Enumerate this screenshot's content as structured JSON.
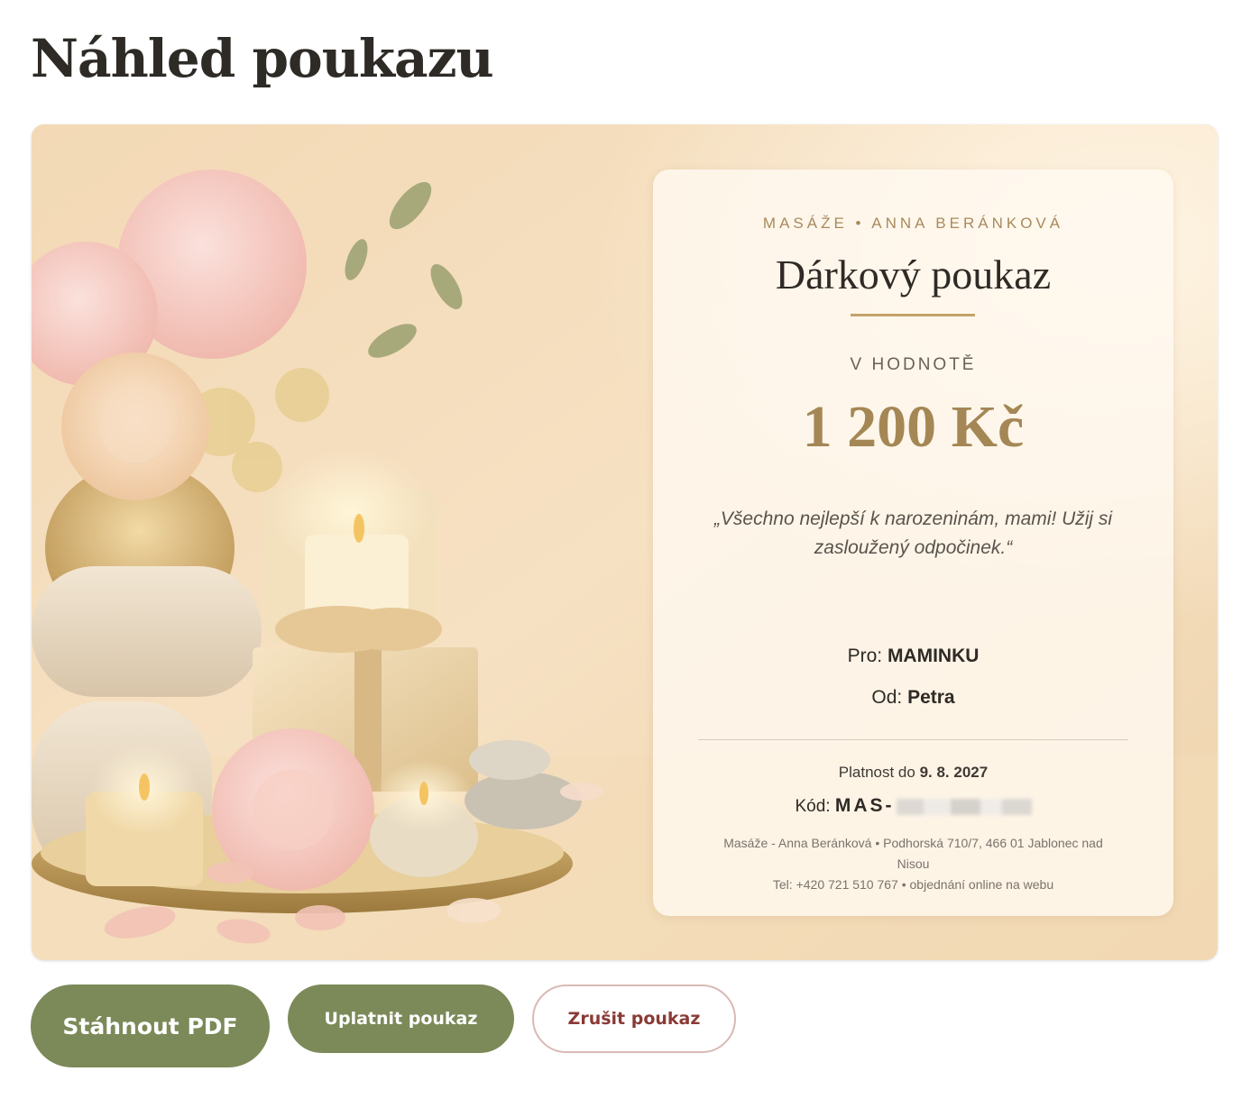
{
  "page": {
    "title": "Náhled poukazu"
  },
  "voucher": {
    "brand": "MASÁŽE • ANNA BERÁNKOVÁ",
    "title": "Dárkový poukaz",
    "value_label": "V HODNOTĚ",
    "value_amount": "1 200 Kč",
    "message": "„Všechno nejlepší k narozeninám, mami! Užij si zasloužený odpočinek.“",
    "recipient_label": "Pro:",
    "recipient_name": "MAMINKU",
    "sender_label": "Od:",
    "sender_name": "Petra",
    "validity_label": "Platnost do",
    "validity_date": "9. 8. 2027",
    "code_label": "Kód:",
    "code_value": "MAS-",
    "address_line1": "Masáže - Anna Beránková • Podhorská 710/7, 466 01 Jablonec nad Nisou",
    "address_line2": "Tel: +420 721 510 767 • objednání online na webu",
    "colors": {
      "accent_gold": "#a48755",
      "divider_gold": "#c4a26a"
    }
  },
  "actions": {
    "download_label": "Stáhnout PDF",
    "redeem_label": "Uplatnit poukaz",
    "cancel_label": "Zrušit poukaz",
    "primary_color": "#7b8a58",
    "danger_color": "#8a3a36"
  }
}
